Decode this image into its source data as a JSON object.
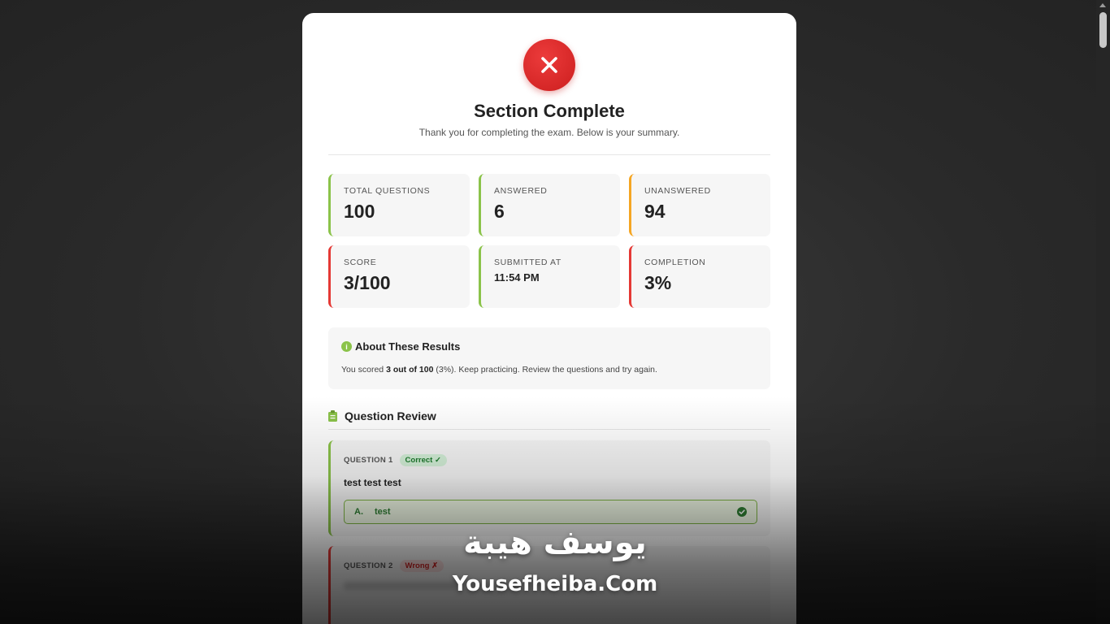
{
  "header": {
    "title": "Section Complete",
    "subtitle": "Thank you for completing the exam. Below is your summary."
  },
  "stats": [
    {
      "label": "TOTAL QUESTIONS",
      "value": "100",
      "accent": "#8bc34a"
    },
    {
      "label": "ANSWERED",
      "value": "6",
      "accent": "#8bc34a"
    },
    {
      "label": "UNANSWERED",
      "value": "94",
      "accent": "#f5a623"
    },
    {
      "label": "SCORE",
      "value": "3/100",
      "accent": "#e53935"
    },
    {
      "label": "SUBMITTED AT",
      "value": "11:54 PM",
      "accent": "#8bc34a"
    },
    {
      "label": "COMPLETION",
      "value": "3%",
      "accent": "#e53935"
    }
  ],
  "about": {
    "title": "About These Results",
    "text_prefix": "You scored ",
    "text_bold": "3 out of 100",
    "text_suffix": " (3%). Keep practicing. Review the questions and try again."
  },
  "review": {
    "title": "Question Review",
    "questions": [
      {
        "number": "QUESTION 1",
        "status": "Correct ✓",
        "text": "test test test",
        "answer_letter": "A.",
        "answer_text": "test"
      },
      {
        "number": "QUESTION 2",
        "status": "Wrong ✗"
      }
    ]
  },
  "watermark": {
    "arabic": "يوسف هيبة",
    "latin": "Yousefheiba.Com"
  },
  "colors": {
    "error": "#e53935",
    "success": "#8bc34a",
    "warning": "#f5a623"
  }
}
